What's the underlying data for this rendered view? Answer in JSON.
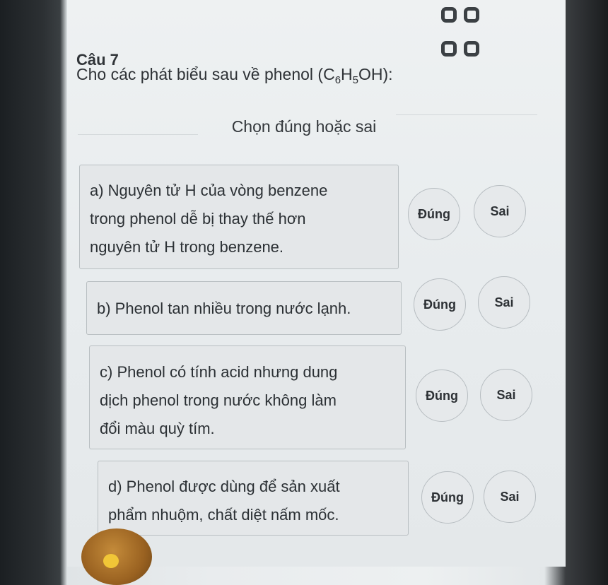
{
  "question": {
    "title": "Câu 7",
    "prompt_prefix": "Cho các phát biểu sau về phenol (C",
    "formula_sub1": "6",
    "formula_mid": "H",
    "formula_sub2": "5",
    "formula_suffix": "OH):"
  },
  "section_title": "Chọn đúng hoặc sai",
  "statements": [
    {
      "label": "a) Nguyên tử H của vòng benzene trong phenol dễ bị thay thế hơn nguyên tử H trong benzene.",
      "lines": [
        "a) Nguyên tử H của vòng benzene",
        "trong phenol dễ bị thay thế hơn",
        "nguyên tử H trong benzene."
      ]
    },
    {
      "label": "b) Phenol tan nhiều trong nước lạnh.",
      "lines": [
        "b) Phenol tan nhiều trong nước lạnh."
      ]
    },
    {
      "label": "c) Phenol có tính acid nhưng dung dịch phenol trong nước không làm đổi màu quỳ tím.",
      "lines": [
        "c) Phenol có tính acid nhưng dung",
        "dịch phenol trong nước không làm",
        "đổi màu quỳ tím."
      ]
    },
    {
      "label": "d) Phenol được dùng để sản xuất phẩm nhuộm, chất diệt nấm mốc.",
      "lines": [
        "d) Phenol được dùng để sản xuất",
        "phẩm nhuộm, chất diệt nấm mốc."
      ]
    }
  ],
  "options": {
    "true_label": "Đúng",
    "false_label": "Sai"
  },
  "icons": {
    "menu": "grid-icon"
  }
}
